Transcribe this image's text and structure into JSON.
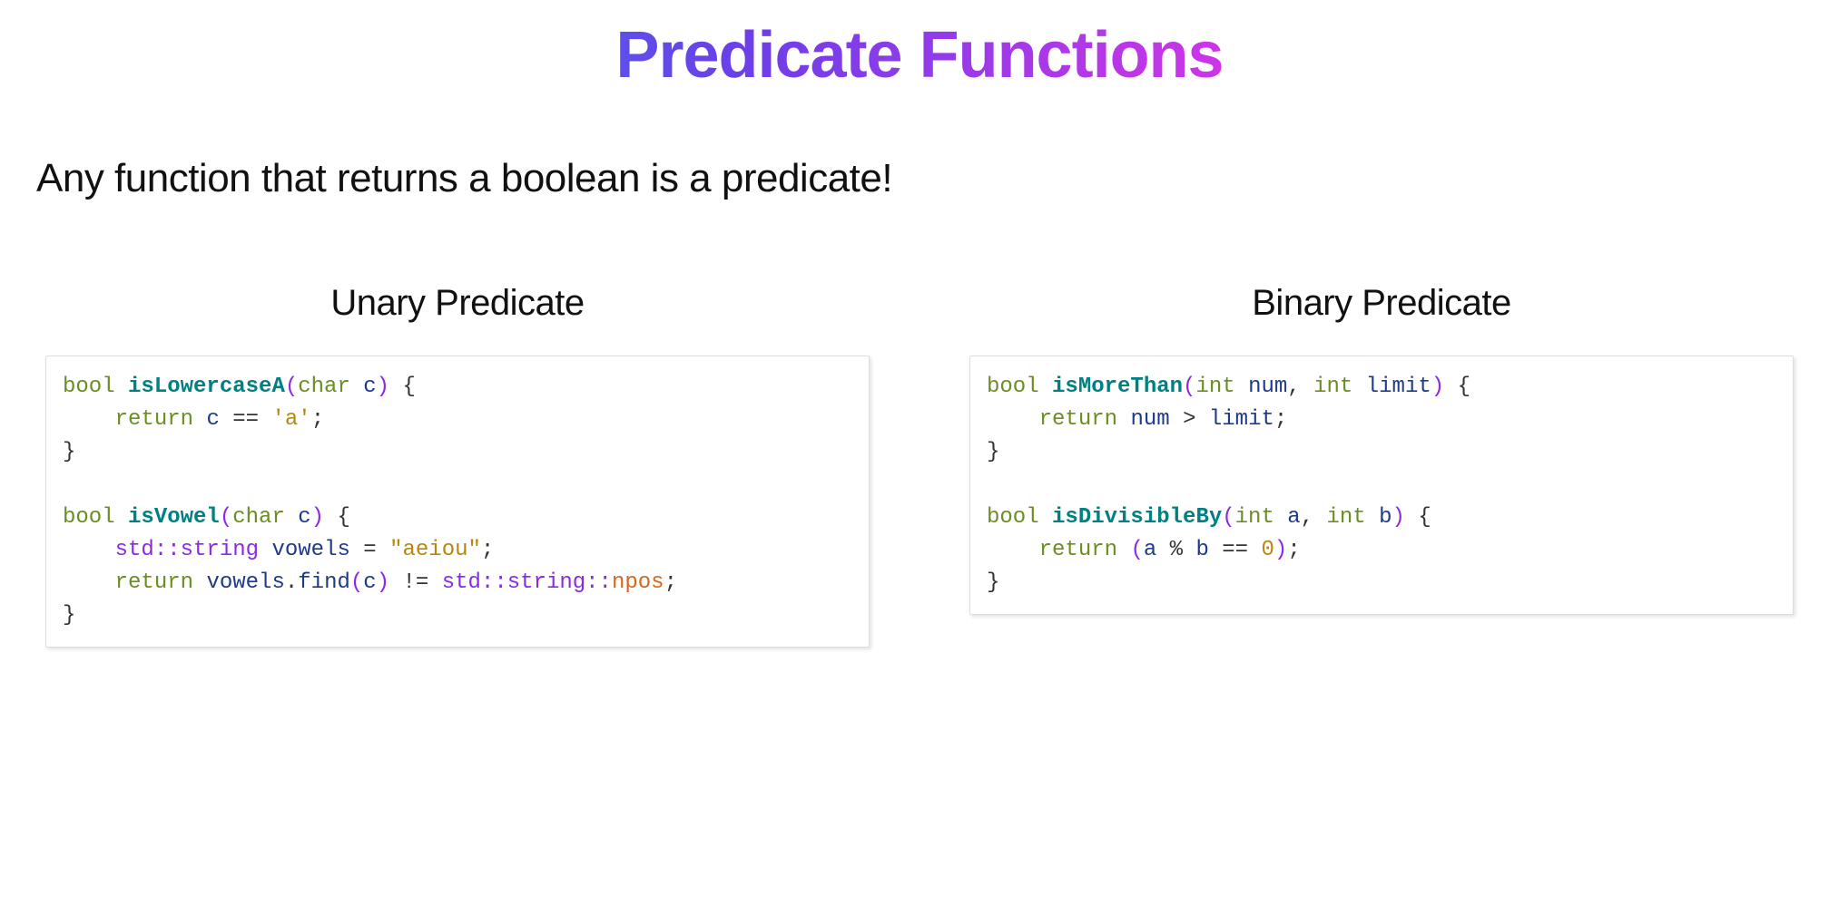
{
  "title": "Predicate Functions",
  "subtitle": "Any function that returns a boolean is a predicate!",
  "left": {
    "heading": "Unary Predicate",
    "code": [
      {
        "type": "type",
        "text": "bool"
      },
      {
        "type": "plain",
        "text": " "
      },
      {
        "type": "func",
        "text": "isLowercaseA"
      },
      {
        "type": "paren",
        "text": "("
      },
      {
        "type": "type",
        "text": "char"
      },
      {
        "type": "plain",
        "text": " "
      },
      {
        "type": "ident",
        "text": "c"
      },
      {
        "type": "paren",
        "text": ")"
      },
      {
        "type": "plain",
        "text": " "
      },
      {
        "type": "brace",
        "text": "{"
      },
      {
        "type": "nl"
      },
      {
        "type": "plain",
        "text": "    "
      },
      {
        "type": "keyword",
        "text": "return"
      },
      {
        "type": "plain",
        "text": " "
      },
      {
        "type": "ident",
        "text": "c"
      },
      {
        "type": "plain",
        "text": " "
      },
      {
        "type": "op",
        "text": "=="
      },
      {
        "type": "plain",
        "text": " "
      },
      {
        "type": "str",
        "text": "'a'"
      },
      {
        "type": "op",
        "text": ";"
      },
      {
        "type": "nl"
      },
      {
        "type": "brace",
        "text": "}"
      },
      {
        "type": "nl"
      },
      {
        "type": "nl"
      },
      {
        "type": "type",
        "text": "bool"
      },
      {
        "type": "plain",
        "text": " "
      },
      {
        "type": "func",
        "text": "isVowel"
      },
      {
        "type": "paren",
        "text": "("
      },
      {
        "type": "type",
        "text": "char"
      },
      {
        "type": "plain",
        "text": " "
      },
      {
        "type": "ident",
        "text": "c"
      },
      {
        "type": "paren",
        "text": ")"
      },
      {
        "type": "plain",
        "text": " "
      },
      {
        "type": "brace",
        "text": "{"
      },
      {
        "type": "nl"
      },
      {
        "type": "plain",
        "text": "    "
      },
      {
        "type": "ns",
        "text": "std::string"
      },
      {
        "type": "plain",
        "text": " "
      },
      {
        "type": "ident",
        "text": "vowels"
      },
      {
        "type": "plain",
        "text": " "
      },
      {
        "type": "op",
        "text": "="
      },
      {
        "type": "plain",
        "text": " "
      },
      {
        "type": "str",
        "text": "\"aeiou\""
      },
      {
        "type": "op",
        "text": ";"
      },
      {
        "type": "nl"
      },
      {
        "type": "plain",
        "text": "    "
      },
      {
        "type": "keyword",
        "text": "return"
      },
      {
        "type": "plain",
        "text": " "
      },
      {
        "type": "ident",
        "text": "vowels"
      },
      {
        "type": "op",
        "text": "."
      },
      {
        "type": "ident",
        "text": "find"
      },
      {
        "type": "paren",
        "text": "("
      },
      {
        "type": "ident",
        "text": "c"
      },
      {
        "type": "paren",
        "text": ")"
      },
      {
        "type": "plain",
        "text": " "
      },
      {
        "type": "op",
        "text": "!="
      },
      {
        "type": "plain",
        "text": " "
      },
      {
        "type": "ns",
        "text": "std::string::"
      },
      {
        "type": "npos",
        "text": "npos"
      },
      {
        "type": "op",
        "text": ";"
      },
      {
        "type": "nl"
      },
      {
        "type": "brace",
        "text": "}"
      }
    ]
  },
  "right": {
    "heading": "Binary Predicate",
    "code": [
      {
        "type": "type",
        "text": "bool"
      },
      {
        "type": "plain",
        "text": " "
      },
      {
        "type": "func",
        "text": "isMoreThan"
      },
      {
        "type": "paren",
        "text": "("
      },
      {
        "type": "type",
        "text": "int"
      },
      {
        "type": "plain",
        "text": " "
      },
      {
        "type": "ident",
        "text": "num"
      },
      {
        "type": "op",
        "text": ","
      },
      {
        "type": "plain",
        "text": " "
      },
      {
        "type": "type",
        "text": "int"
      },
      {
        "type": "plain",
        "text": " "
      },
      {
        "type": "ident",
        "text": "limit"
      },
      {
        "type": "paren",
        "text": ")"
      },
      {
        "type": "plain",
        "text": " "
      },
      {
        "type": "brace",
        "text": "{"
      },
      {
        "type": "nl"
      },
      {
        "type": "plain",
        "text": "    "
      },
      {
        "type": "keyword",
        "text": "return"
      },
      {
        "type": "plain",
        "text": " "
      },
      {
        "type": "ident",
        "text": "num"
      },
      {
        "type": "plain",
        "text": " "
      },
      {
        "type": "op",
        "text": ">"
      },
      {
        "type": "plain",
        "text": " "
      },
      {
        "type": "ident",
        "text": "limit"
      },
      {
        "type": "op",
        "text": ";"
      },
      {
        "type": "nl"
      },
      {
        "type": "brace",
        "text": "}"
      },
      {
        "type": "nl"
      },
      {
        "type": "nl"
      },
      {
        "type": "type",
        "text": "bool"
      },
      {
        "type": "plain",
        "text": " "
      },
      {
        "type": "func",
        "text": "isDivisibleBy"
      },
      {
        "type": "paren",
        "text": "("
      },
      {
        "type": "type",
        "text": "int"
      },
      {
        "type": "plain",
        "text": " "
      },
      {
        "type": "ident",
        "text": "a"
      },
      {
        "type": "op",
        "text": ","
      },
      {
        "type": "plain",
        "text": " "
      },
      {
        "type": "type",
        "text": "int"
      },
      {
        "type": "plain",
        "text": " "
      },
      {
        "type": "ident",
        "text": "b"
      },
      {
        "type": "paren",
        "text": ")"
      },
      {
        "type": "plain",
        "text": " "
      },
      {
        "type": "brace",
        "text": "{"
      },
      {
        "type": "nl"
      },
      {
        "type": "plain",
        "text": "    "
      },
      {
        "type": "keyword",
        "text": "return"
      },
      {
        "type": "plain",
        "text": " "
      },
      {
        "type": "paren",
        "text": "("
      },
      {
        "type": "ident",
        "text": "a"
      },
      {
        "type": "plain",
        "text": " "
      },
      {
        "type": "op",
        "text": "%"
      },
      {
        "type": "plain",
        "text": " "
      },
      {
        "type": "ident",
        "text": "b"
      },
      {
        "type": "plain",
        "text": " "
      },
      {
        "type": "op",
        "text": "=="
      },
      {
        "type": "plain",
        "text": " "
      },
      {
        "type": "num",
        "text": "0"
      },
      {
        "type": "paren",
        "text": ")"
      },
      {
        "type": "op",
        "text": ";"
      },
      {
        "type": "nl"
      },
      {
        "type": "brace",
        "text": "}"
      }
    ]
  }
}
